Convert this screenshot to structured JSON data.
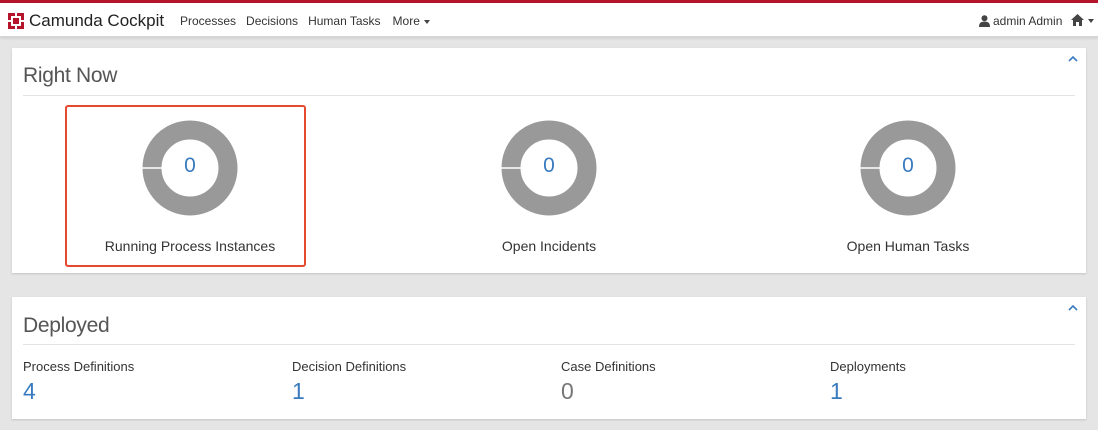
{
  "app": {
    "brand": "Camunda Cockpit",
    "accent_color": "#b5152b",
    "link_color": "#3a7bbf",
    "highlight_color": "#e64a2e"
  },
  "nav": {
    "items": [
      "Processes",
      "Decisions",
      "Human Tasks"
    ],
    "more_label": "More"
  },
  "user": {
    "name": "admin Admin",
    "icon": "user-icon"
  },
  "home": {
    "icon": "home-icon"
  },
  "right_now": {
    "title": "Right Now",
    "stats": [
      {
        "label": "Running Process Instances",
        "value": "0"
      },
      {
        "label": "Open Incidents",
        "value": "0"
      },
      {
        "label": "Open Human Tasks",
        "value": "0"
      }
    ]
  },
  "deployed": {
    "title": "Deployed",
    "items": [
      {
        "label": "Process Definitions",
        "value": "4",
        "color": "#3a7bbf"
      },
      {
        "label": "Decision Definitions",
        "value": "1",
        "color": "#3a7bbf"
      },
      {
        "label": "Case Definitions",
        "value": "0",
        "color": "#777777"
      },
      {
        "label": "Deployments",
        "value": "1",
        "color": "#3a7bbf"
      }
    ]
  }
}
